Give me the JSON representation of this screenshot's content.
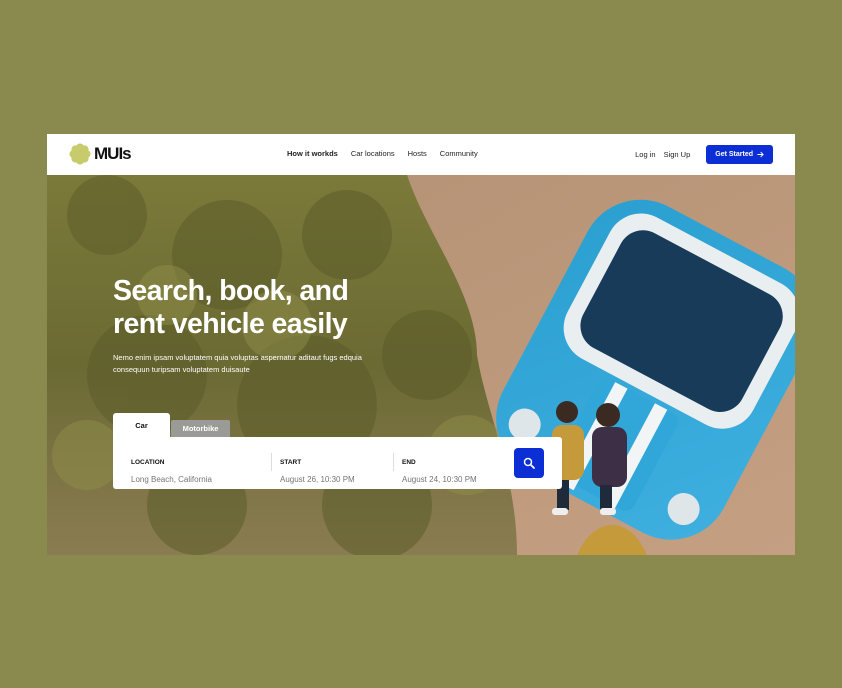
{
  "brand": {
    "name": "MUIs",
    "mark_color": "#c7cb6c",
    "accent": "#0b2fd4"
  },
  "nav": {
    "links": [
      {
        "label": "How it workds",
        "active": true
      },
      {
        "label": "Car locations"
      },
      {
        "label": "Hosts"
      },
      {
        "label": "Community"
      }
    ],
    "login": "Log in",
    "signup": "Sign Up",
    "cta": "Get Started"
  },
  "hero": {
    "title": "Search, book, and\nrent vehicle easily",
    "subtitle": "Nemo enim ipsam voluptatem quia voluptas aspernatur aditaut fugs edquia consequun turipsam voluptatem duisaute"
  },
  "search": {
    "tabs": [
      "Car",
      "Motorbike"
    ],
    "active_tab": "Car",
    "fields": {
      "location": {
        "label": "LOCATION",
        "placeholder": "Long Beach, California"
      },
      "start": {
        "label": "START",
        "placeholder": "August 26, 10:30 PM"
      },
      "end": {
        "label": "END",
        "placeholder": "August 24, 10:30 PM"
      }
    },
    "button_icon": "search-icon"
  }
}
